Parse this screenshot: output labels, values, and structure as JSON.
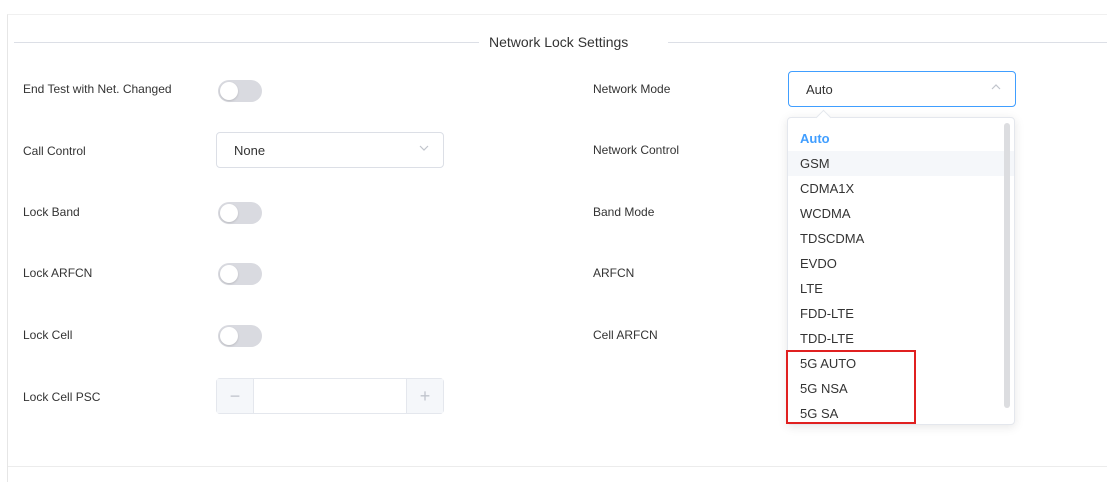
{
  "section": {
    "title": "Network Lock Settings"
  },
  "left": {
    "end_test": {
      "label": "End Test with Net. Changed",
      "on": false
    },
    "call_control": {
      "label": "Call Control",
      "value": "None"
    },
    "lock_band": {
      "label": "Lock Band",
      "on": false
    },
    "lock_arfcn": {
      "label": "Lock ARFCN",
      "on": false
    },
    "lock_cell": {
      "label": "Lock Cell",
      "on": false
    },
    "lock_cell_psc": {
      "label": "Lock Cell PSC",
      "minus": "−",
      "plus": "+"
    }
  },
  "right": {
    "network_mode": {
      "label": "Network Mode",
      "value": "Auto"
    },
    "network_control": {
      "label": "Network Control"
    },
    "band_mode": {
      "label": "Band Mode"
    },
    "arfcn": {
      "label": "ARFCN"
    },
    "cell_arfcn": {
      "label": "Cell ARFCN"
    }
  },
  "dropdown": {
    "options": [
      "Auto",
      "GSM",
      "CDMA1X",
      "WCDMA",
      "TDSCDMA",
      "EVDO",
      "LTE",
      "FDD-LTE",
      "TDD-LTE",
      "5G AUTO",
      "5G NSA",
      "5G SA"
    ],
    "selected": "Auto",
    "hovered": "GSM"
  },
  "colors": {
    "accent": "#409eff",
    "highlight": "#e02020",
    "switch_off": "#d9dae0"
  }
}
